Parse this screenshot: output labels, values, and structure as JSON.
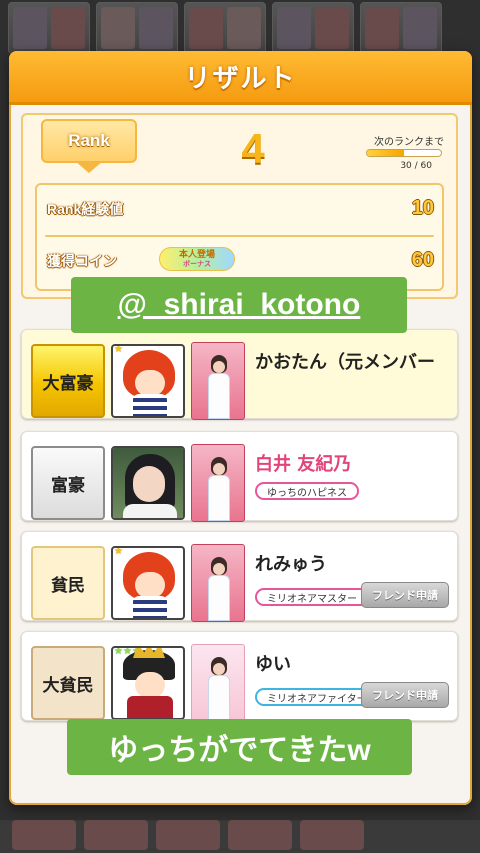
{
  "dialog": {
    "title": "リザルト"
  },
  "rank": {
    "badge_label": "Rank",
    "value": "4",
    "next_rank_label": "次のランクまで",
    "progress_current": 30,
    "progress_total": 60,
    "progress_text": "30 / 60",
    "progress_fraction": 0.5
  },
  "stats": {
    "exp_label": "Rank経験値",
    "exp_value": "10",
    "coin_label": "獲得コイン",
    "coin_value": "60",
    "bonus_line1": "本人登場",
    "bonus_line2": "ボーナス"
  },
  "overlay": {
    "handle": "@_shirai_kotono",
    "caption": "ゆっちがでてきたw"
  },
  "rankings": [
    {
      "title": "大富豪",
      "name": "かおたん（元メンバー",
      "tag": "",
      "friend_button": ""
    },
    {
      "title": "富豪",
      "name": "白井 友紀乃",
      "tag": "ゆっちのハピネス",
      "friend_button": ""
    },
    {
      "title": "貧民",
      "name": "れみゅう",
      "tag": "ミリオネアマスター",
      "friend_button": "フレンド申請"
    },
    {
      "title": "大貧民",
      "name": "ゆい",
      "tag": "ミリオネアファイター",
      "friend_button": "フレンド申請"
    }
  ],
  "colors": {
    "header": "#f59b10",
    "accent_gold": "#f7b51a",
    "tag_green": "#6cb545",
    "name_pink": "#e2447a"
  }
}
